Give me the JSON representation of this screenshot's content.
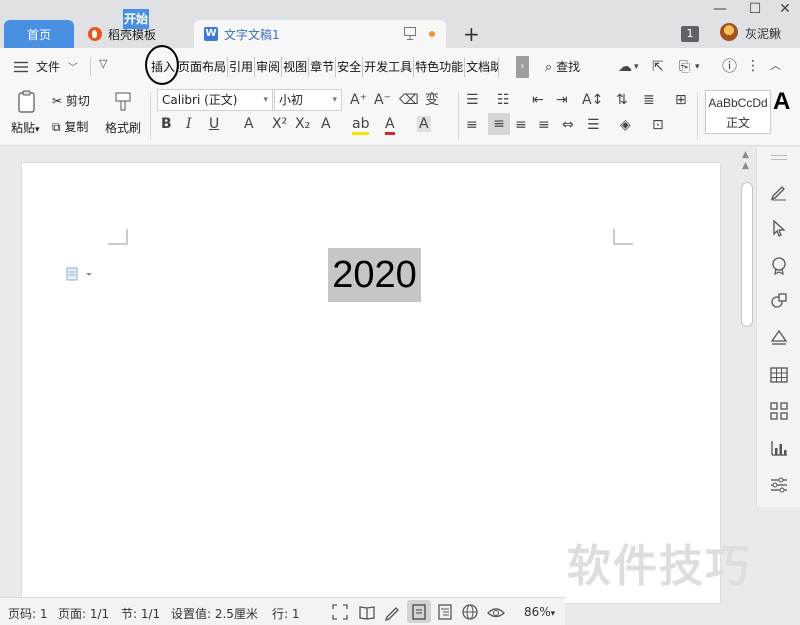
{
  "tabbar": {
    "home_tab": "首页",
    "daoke_tab": "稻壳模板",
    "doc_tab": "文字文稿1",
    "add_tab": "+",
    "notification_count": "1",
    "username": "灰泥鳅",
    "window_controls": [
      "—",
      "☐",
      "✕"
    ]
  },
  "menu": {
    "file_label": "文件",
    "start_tab": "开始",
    "ribbon_tabs": [
      "插入",
      "页面布局",
      "引用",
      "审阅",
      "视图",
      "章节",
      "安全",
      "开发工具",
      "特色功能",
      "文档助"
    ],
    "search_label": "查找"
  },
  "toolbar": {
    "paste_label": "粘贴",
    "cut_label": "剪切",
    "copy_label": "复制",
    "format_painter_label": "格式刷",
    "font_name": "Calibri (正文)",
    "font_size": "小初",
    "style_preview": "AaBbCcDd",
    "style_name": "正文",
    "big_style_letter": "A"
  },
  "document": {
    "title_text": "2020"
  },
  "watermark": "软件技巧",
  "statusbar": {
    "page_no": "页码: 1",
    "pages": "页面: 1/1",
    "section": "节: 1/1",
    "setting": "设置值: 2.5厘米",
    "line": "行: 1",
    "zoom": "86%"
  },
  "colors": {
    "accent": "#4a90e2",
    "doc_tab_dot": "#f0953a",
    "selection_gray": "#c6c6c6",
    "daoke_logo": "#e8571e"
  }
}
